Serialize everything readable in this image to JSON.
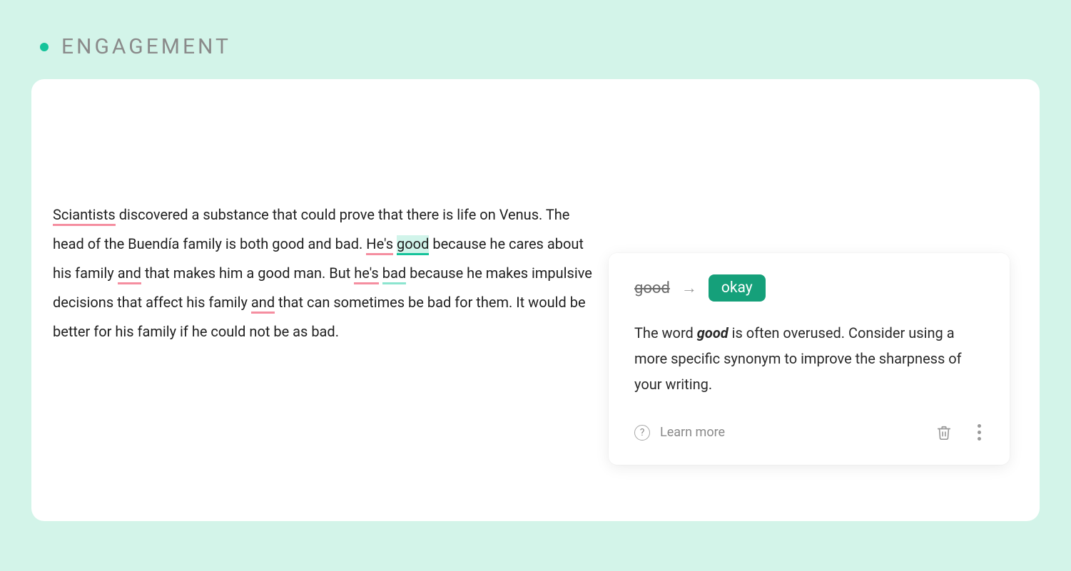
{
  "header": {
    "title": "ENGAGEMENT"
  },
  "editor": {
    "segments": [
      {
        "text": "Sciantists",
        "mark": "pink"
      },
      {
        "text": " discovered a substance that could prove that there is life on Venus. The head of the Buendía family is both good and bad. "
      },
      {
        "text": "He's",
        "mark": "pink"
      },
      {
        "text": " "
      },
      {
        "text": "good",
        "mark": "green"
      },
      {
        "text": " because he cares about his family "
      },
      {
        "text": "and",
        "mark": "pink"
      },
      {
        "text": " that makes him a good man. But "
      },
      {
        "text": "he's",
        "mark": "pink"
      },
      {
        "text": " "
      },
      {
        "text": "bad",
        "mark": "mint"
      },
      {
        "text": " because he makes impulsive decisions that affect his family "
      },
      {
        "text": "and",
        "mark": "pink"
      },
      {
        "text": " that can sometimes be bad for them. It would be better for his family if he could not be as bad."
      }
    ]
  },
  "suggestion": {
    "original": "good",
    "replacement": "okay",
    "explanation_prefix": "The word ",
    "explanation_word": "good",
    "explanation_suffix": " is often overused. Consider using a more specific synonym to improve the sharpness of your writing.",
    "learn_more": "Learn more"
  }
}
